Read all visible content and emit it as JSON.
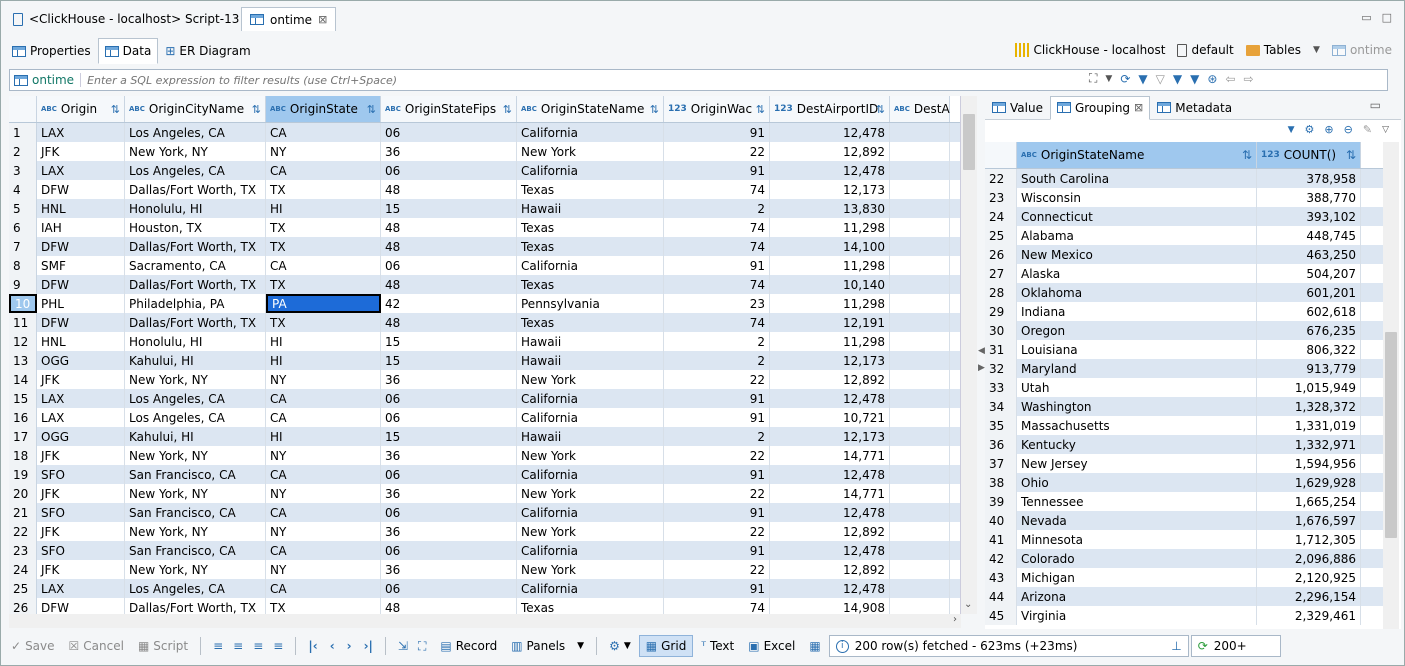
{
  "editor_tabs": [
    {
      "label": "<ClickHouse - localhost> Script-13",
      "active": false
    },
    {
      "label": "ontime",
      "active": true
    }
  ],
  "sub_tabs": [
    {
      "label": "Properties"
    },
    {
      "label": "Data",
      "active": true
    },
    {
      "label": "ER Diagram"
    }
  ],
  "context": {
    "connection": "ClickHouse - localhost",
    "database": "default",
    "folder": "Tables",
    "object": "ontime"
  },
  "filter": {
    "table": "ontime",
    "placeholder": "Enter a SQL expression to filter results (use Ctrl+Space)"
  },
  "grid": {
    "columns": [
      {
        "name": "Origin",
        "type": "abc"
      },
      {
        "name": "OriginCityName",
        "type": "abc"
      },
      {
        "name": "OriginState",
        "type": "abc",
        "selected": true
      },
      {
        "name": "OriginStateFips",
        "type": "abc"
      },
      {
        "name": "OriginStateName",
        "type": "abc"
      },
      {
        "name": "OriginWac",
        "type": "123"
      },
      {
        "name": "DestAirportID",
        "type": "123"
      },
      {
        "name": "DestA",
        "type": "abc"
      }
    ],
    "rows": [
      [
        "1",
        "LAX",
        "Los Angeles, CA",
        "CA",
        "06",
        "California",
        "91",
        "12,478"
      ],
      [
        "2",
        "JFK",
        "New York, NY",
        "NY",
        "36",
        "New York",
        "22",
        "12,892"
      ],
      [
        "3",
        "LAX",
        "Los Angeles, CA",
        "CA",
        "06",
        "California",
        "91",
        "12,478"
      ],
      [
        "4",
        "DFW",
        "Dallas/Fort Worth, TX",
        "TX",
        "48",
        "Texas",
        "74",
        "12,173"
      ],
      [
        "5",
        "HNL",
        "Honolulu, HI",
        "HI",
        "15",
        "Hawaii",
        "2",
        "13,830"
      ],
      [
        "6",
        "IAH",
        "Houston, TX",
        "TX",
        "48",
        "Texas",
        "74",
        "11,298"
      ],
      [
        "7",
        "DFW",
        "Dallas/Fort Worth, TX",
        "TX",
        "48",
        "Texas",
        "74",
        "14,100"
      ],
      [
        "8",
        "SMF",
        "Sacramento, CA",
        "CA",
        "06",
        "California",
        "91",
        "11,298"
      ],
      [
        "9",
        "DFW",
        "Dallas/Fort Worth, TX",
        "TX",
        "48",
        "Texas",
        "74",
        "10,140"
      ],
      [
        "10",
        "PHL",
        "Philadelphia, PA",
        "PA",
        "42",
        "Pennsylvania",
        "23",
        "11,298"
      ],
      [
        "11",
        "DFW",
        "Dallas/Fort Worth, TX",
        "TX",
        "48",
        "Texas",
        "74",
        "12,191"
      ],
      [
        "12",
        "HNL",
        "Honolulu, HI",
        "HI",
        "15",
        "Hawaii",
        "2",
        "11,298"
      ],
      [
        "13",
        "OGG",
        "Kahului, HI",
        "HI",
        "15",
        "Hawaii",
        "2",
        "12,173"
      ],
      [
        "14",
        "JFK",
        "New York, NY",
        "NY",
        "36",
        "New York",
        "22",
        "12,892"
      ],
      [
        "15",
        "LAX",
        "Los Angeles, CA",
        "CA",
        "06",
        "California",
        "91",
        "12,478"
      ],
      [
        "16",
        "LAX",
        "Los Angeles, CA",
        "CA",
        "06",
        "California",
        "91",
        "10,721"
      ],
      [
        "17",
        "OGG",
        "Kahului, HI",
        "HI",
        "15",
        "Hawaii",
        "2",
        "12,173"
      ],
      [
        "18",
        "JFK",
        "New York, NY",
        "NY",
        "36",
        "New York",
        "22",
        "14,771"
      ],
      [
        "19",
        "SFO",
        "San Francisco, CA",
        "CA",
        "06",
        "California",
        "91",
        "12,478"
      ],
      [
        "20",
        "JFK",
        "New York, NY",
        "NY",
        "36",
        "New York",
        "22",
        "14,771"
      ],
      [
        "21",
        "SFO",
        "San Francisco, CA",
        "CA",
        "06",
        "California",
        "91",
        "12,478"
      ],
      [
        "22",
        "JFK",
        "New York, NY",
        "NY",
        "36",
        "New York",
        "22",
        "12,892"
      ],
      [
        "23",
        "SFO",
        "San Francisco, CA",
        "CA",
        "06",
        "California",
        "91",
        "12,478"
      ],
      [
        "24",
        "JFK",
        "New York, NY",
        "NY",
        "36",
        "New York",
        "22",
        "12,892"
      ],
      [
        "25",
        "LAX",
        "Los Angeles, CA",
        "CA",
        "06",
        "California",
        "91",
        "12,478"
      ],
      [
        "26",
        "DFW",
        "Dallas/Fort Worth, TX",
        "TX",
        "48",
        "Texas",
        "74",
        "14,908"
      ]
    ],
    "current_row": "10"
  },
  "right_panel": {
    "tabs": [
      {
        "label": "Value"
      },
      {
        "label": "Grouping",
        "active": true
      },
      {
        "label": "Metadata"
      }
    ],
    "columns": [
      {
        "name": "OriginStateName",
        "type": "abc"
      },
      {
        "name": "COUNT()",
        "type": "123"
      }
    ],
    "rows": [
      [
        "22",
        "South Carolina",
        "378,958"
      ],
      [
        "23",
        "Wisconsin",
        "388,770"
      ],
      [
        "24",
        "Connecticut",
        "393,102"
      ],
      [
        "25",
        "Alabama",
        "448,745"
      ],
      [
        "26",
        "New Mexico",
        "463,250"
      ],
      [
        "27",
        "Alaska",
        "504,207"
      ],
      [
        "28",
        "Oklahoma",
        "601,201"
      ],
      [
        "29",
        "Indiana",
        "602,618"
      ],
      [
        "30",
        "Oregon",
        "676,235"
      ],
      [
        "31",
        "Louisiana",
        "806,322"
      ],
      [
        "32",
        "Maryland",
        "913,779"
      ],
      [
        "33",
        "Utah",
        "1,015,949"
      ],
      [
        "34",
        "Washington",
        "1,328,372"
      ],
      [
        "35",
        "Massachusetts",
        "1,331,019"
      ],
      [
        "36",
        "Kentucky",
        "1,332,971"
      ],
      [
        "37",
        "New Jersey",
        "1,594,956"
      ],
      [
        "38",
        "Ohio",
        "1,629,928"
      ],
      [
        "39",
        "Tennessee",
        "1,665,254"
      ],
      [
        "40",
        "Nevada",
        "1,676,597"
      ],
      [
        "41",
        "Minnesota",
        "1,712,305"
      ],
      [
        "42",
        "Colorado",
        "2,096,886"
      ],
      [
        "43",
        "Michigan",
        "2,120,925"
      ],
      [
        "44",
        "Arizona",
        "2,296,154"
      ],
      [
        "45",
        "Virginia",
        "2,329,461"
      ]
    ]
  },
  "bottom": {
    "save": "Save",
    "cancel": "Cancel",
    "script": "Script",
    "record": "Record",
    "panels": "Panels",
    "grid": "Grid",
    "text": "Text",
    "excel": "Excel",
    "status": "200 row(s) fetched - 623ms (+23ms)",
    "fetch": "200+"
  },
  "colors": {
    "accent": "#2a6fb0",
    "selected_header": "#9fc8ee",
    "stripe": "#dce6f2",
    "current_cell": "#1d6bd8"
  }
}
